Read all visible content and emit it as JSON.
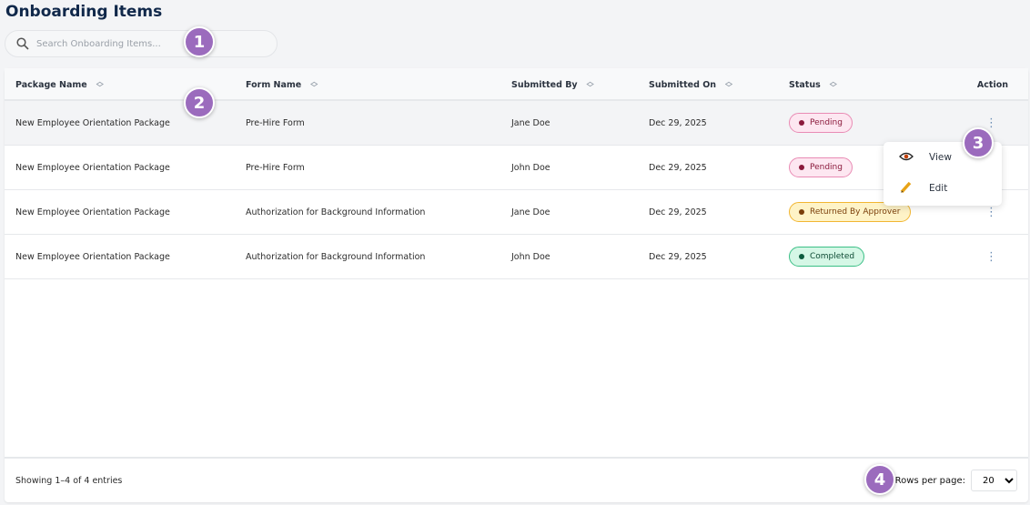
{
  "title": "Onboarding Items",
  "search": {
    "placeholder": "Search Onboarding Items..."
  },
  "columns": [
    "Package Name",
    "Form Name",
    "Submitted By",
    "Submitted On",
    "Status",
    "Action"
  ],
  "rows": [
    {
      "package": "New Employee Orientation Package",
      "form": "Pre-Hire Form",
      "by": "Jane Doe",
      "on": "Dec 29, 2025",
      "status": "Pending"
    },
    {
      "package": "New Employee Orientation Package",
      "form": "Pre-Hire Form",
      "by": "John Doe",
      "on": "Dec 29, 2025",
      "status": "Pending"
    },
    {
      "package": "New Employee Orientation Package",
      "form": "Authorization for Background Information",
      "by": "Jane Doe",
      "on": "Dec 29, 2025",
      "status": "Returned By Approver"
    },
    {
      "package": "New Employee Orientation Package",
      "form": "Authorization for Background Information",
      "by": "John Doe",
      "on": "Dec 29, 2025",
      "status": "Completed"
    }
  ],
  "menu": {
    "view": "View",
    "edit": "Edit"
  },
  "footer": {
    "showing": "Showing 1–4 of 4 entries",
    "rows_per_page_label": "Rows per page:",
    "rows_per_page": "20"
  },
  "callouts": [
    "1",
    "2",
    "3",
    "4"
  ],
  "colors": {
    "pending": "#e0669c",
    "returned": "#f2b632",
    "completed": "#2bb37a",
    "callout": "#9b6bbd"
  }
}
